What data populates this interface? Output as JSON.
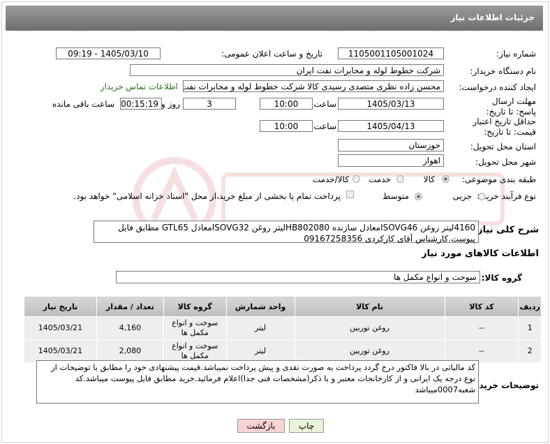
{
  "header": {
    "title": "جزئیات اطلاعات نیاز"
  },
  "form": {
    "need_number_label": "شماره نیاز:",
    "need_number": "1105001105001024",
    "announce_label": "تاریخ و ساعت اعلان عمومی:",
    "announce_value": "1405/03/10 - 09:19",
    "buyer_label": "نام دستگاه خریدار:",
    "buyer_value": "شرکت خطوط لوله و مخابرات نفت ایران",
    "creator_label": "ایجاد کننده درخواست:",
    "creator_value": "محسن زاده نظری متصدی رسیدی کالا شرکت خطوط لوله و مخابرات نفت ایران",
    "contact_link": "اطلاعات تماس خریدار",
    "deadline_label": "مهلت ارسال پاسخ: تا تاریخ:",
    "deadline_date": "1405/03/13",
    "time_label": "ساعت",
    "deadline_time": "10:00",
    "days_value": "3",
    "days_label": "روز و",
    "remaining_time": "00:15:19",
    "remaining_label": "ساعت باقی مانده",
    "validity_label": "حداقل تاریخ اعتبار قیمت: تا تاریخ:",
    "validity_date": "1405/04/13",
    "validity_time": "10:00",
    "province_label": "استان محل تحویل:",
    "province_value": "خوزستان",
    "city_label": "شهر محل تحویل:",
    "city_value": "اهواز",
    "category_label": "طبقه بندی موضوعی:",
    "category_options": [
      "کالا",
      "خدمت",
      "کالا/خدمت"
    ],
    "purchase_label": "نوع فرآیند خرید :",
    "purchase_options": [
      "جزیی",
      "متوسط"
    ],
    "payment_note": "پرداخت تمام یا بخشی از مبلغ خرید،از محل \"اسناد خزانه اسلامی\" خواهد بود.",
    "description_label": "شرح کلی نیاز:",
    "description_value": "4160لیتر روغن ISOVG46معادل سازنده HB802080لیتر روغن ISOVG32معادل GTL65 مطابق فایل پیوست.کارشناس آقای کارکردی 09167258356"
  },
  "goods": {
    "section_title": "اطلاعات کالاهای مورد نیاز",
    "group_label": "گروه کالا:",
    "group_value": "سوخت و انواع مکمل ها",
    "columns": [
      "ردیف",
      "کد کالا",
      "نام کالا",
      "واحد شمارش",
      "گروه کالا",
      "تعداد / مقدار",
      "تاریخ نیاز"
    ],
    "rows": [
      [
        "1",
        "--",
        "روغن توربین",
        "لیتر",
        "سوخت و انواع مکمل ها",
        "4,160",
        "1405/03/21"
      ],
      [
        "2",
        "--",
        "روغن توربین",
        "لیتر",
        "سوخت و انواع مکمل ها",
        "2,080",
        "1405/03/21"
      ]
    ]
  },
  "notes": {
    "label": "توضیحات خریدار:",
    "value": "کد مالیاتی در بالا فاکتور درج گردد پرداخت به صورت نقدی و پیش پرداخت نمیباشد.قیمت پیشنهادی خود را مطابق با توضیحات از نوع درجه یک ایرانی و از کارخانجات معتبر و با ذکر(مشخصات فنی جدا)اعلام فرمائید.خرید مطابق فایل پیوست میباشد.کد شعبه0007میباشد"
  },
  "buttons": {
    "print": "چاپ",
    "back": "بازگشت"
  },
  "colors": {
    "header": "#7f7f7f",
    "link": "#2d6f1f",
    "back_button": "#f7d3d3",
    "print_button": "#e8f3dc"
  }
}
